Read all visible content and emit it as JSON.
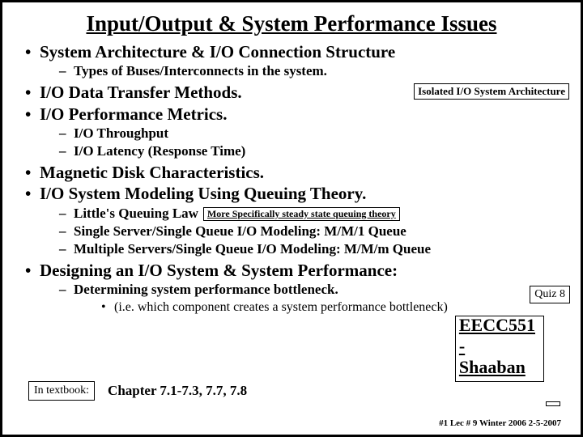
{
  "title": "Input/Output & System Performance Issues",
  "b1": {
    "t": "System Architecture & I/O Connection Structure",
    "s1": "Types of Buses/Interconnects in the system.",
    "iso": "Isolated I/O System Architecture"
  },
  "b2": {
    "t": "I/O Data Transfer Methods."
  },
  "b3": {
    "t": "I/O Performance Metrics.",
    "s1": "I/O Throughput",
    "s2": "I/O Latency (Response Time)"
  },
  "b4": {
    "t": "Magnetic Disk Characteristics."
  },
  "b5": {
    "t": "I/O System Modeling Using Queuing Theory.",
    "s1": "Little's Queuing Law",
    "s2": "Single Server/Single Queue I/O Modeling: M/M/1 Queue",
    "s3": "Multiple Servers/Single Queue I/O Modeling: M/M/m Queue",
    "qnote": "More Specifically steady state queuing theory"
  },
  "b6": {
    "t": "Designing an I/O System & System Performance:",
    "s1": "Determining system performance bottleneck.",
    "ss1": "(i.e. which component creates a system performance bottleneck)"
  },
  "quiz": "Quiz 8",
  "textbook_label": "In textbook:",
  "chapters": "Chapter  7.1-7.3,   7.7, 7.8",
  "course": "EECC551 - Shaaban",
  "meta": "#1   Lec # 9   Winter 2006  2-5-2007"
}
